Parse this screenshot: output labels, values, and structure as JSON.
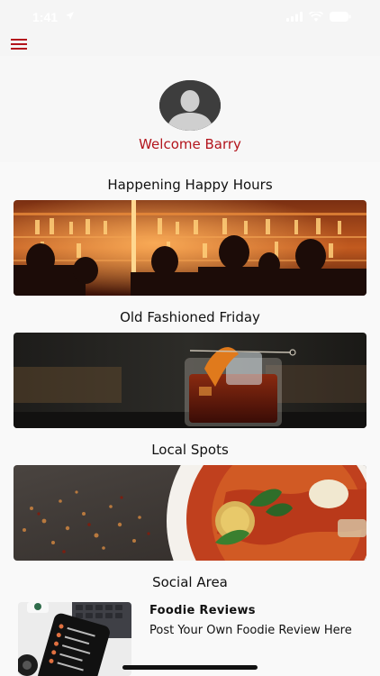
{
  "status_bar": {
    "time": "1:41"
  },
  "header": {
    "menu_icon": "hamburger-menu-icon"
  },
  "profile": {
    "avatar_icon": "default-user-avatar",
    "welcome_text": "Welcome Barry"
  },
  "sections": [
    {
      "title": "Happening Happy Hours",
      "image": "bar-crowd-photo"
    },
    {
      "title": "Old Fashioned Friday",
      "image": "old-fashioned-cocktail-photo"
    },
    {
      "title": "Local Spots",
      "image": "pasta-dish-photo"
    },
    {
      "title": "Social Area"
    }
  ],
  "social": {
    "title": "Foodie Reviews",
    "subtitle": "Post Your Own Foodie Review Here",
    "image": "phone-on-desk-photo"
  },
  "colors": {
    "accent": "#b3141c",
    "background": "#f5f5f5"
  }
}
